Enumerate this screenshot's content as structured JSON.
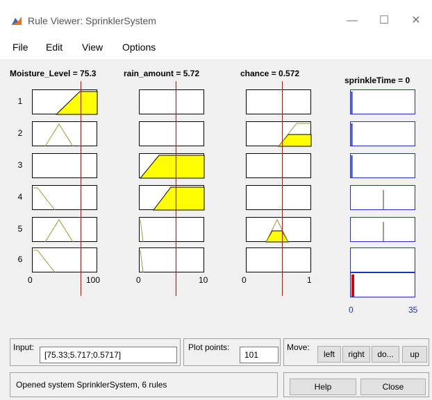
{
  "window": {
    "title": "Rule Viewer: SprinklerSystem"
  },
  "titlebar_buttons": {
    "minimize": "—",
    "maximize": "☐",
    "close": "✕"
  },
  "menu": [
    "File",
    "Edit",
    "View",
    "Options"
  ],
  "variables": {
    "moisture": {
      "label": "Moisture_Level = 75.3",
      "ticks": [
        "0",
        "100"
      ]
    },
    "rain": {
      "label": "rain_amount = 5.72",
      "ticks": [
        "0",
        "10"
      ]
    },
    "chance": {
      "label": "chance = 0.572",
      "ticks": [
        "0",
        "1"
      ]
    },
    "sprinkle": {
      "label": "sprinkleTime = 0",
      "ticks": [
        "0",
        "35"
      ]
    }
  },
  "rules": [
    "1",
    "2",
    "3",
    "4",
    "5",
    "6"
  ],
  "colors": {
    "fill": "#ffff00",
    "input_line": "#e00000",
    "output_border": "#1f2fbf",
    "output_bar": "#e00000"
  },
  "input_panel": {
    "label": "Input:",
    "value": "[75.33;5.717;0.5717]"
  },
  "plot_panel": {
    "label": "Plot points:",
    "value": "101"
  },
  "move_panel": {
    "label": "Move:",
    "buttons": [
      "left",
      "right",
      "do...",
      "up"
    ]
  },
  "status": {
    "text": "Opened system SprinklerSystem, 6 rules"
  },
  "buttons": {
    "help": "Help",
    "close": "Close"
  }
}
